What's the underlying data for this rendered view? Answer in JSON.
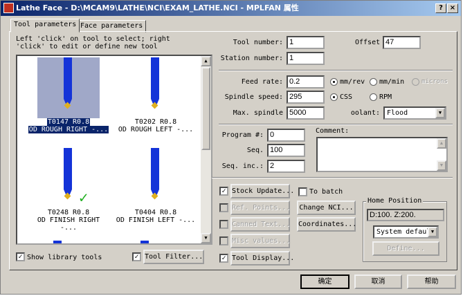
{
  "window": {
    "title": "Lathe Face - D:\\MCAM9\\LATHE\\NCI\\EXAM_LATHE.NCI - MPLFAN 属性",
    "help_btn": "?",
    "close_btn": "×"
  },
  "tabs": [
    {
      "label": "Tool parameters"
    },
    {
      "label": "Face parameters"
    }
  ],
  "instructions": [
    "Left 'click' on tool to select; right",
    "'click' to edit or define new tool"
  ],
  "tools": [
    {
      "id": "T0147 R0.8",
      "name": "OD ROUGH RIGHT -...",
      "selected": true
    },
    {
      "id": "T0202 R0.8",
      "name": "OD ROUGH LEFT -..."
    },
    {
      "id": "T0248 R0.8",
      "name": "OD FINISH RIGHT -...",
      "check": "✓"
    },
    {
      "id": "T0404 R0.8",
      "name": "OD FINISH LEFT -..."
    }
  ],
  "show_library": {
    "label": "Show library tools",
    "checked": "✓"
  },
  "tool_filter": {
    "label": "Tool Filter...",
    "checked": "✓"
  },
  "fields": {
    "tool_number": {
      "label": "Tool number:",
      "value": "1"
    },
    "offset": {
      "label": "Offset",
      "value": "47"
    },
    "station_number": {
      "label": "Station number:",
      "value": "1"
    },
    "feed_rate": {
      "label": "Feed rate:",
      "value": "0.2"
    },
    "spindle_speed": {
      "label": "Spindle speed:",
      "value": "295"
    },
    "max_spindle": {
      "label": "Max. spindle",
      "value": "5000"
    },
    "coolant": {
      "label": "oolant:",
      "value": "Flood"
    },
    "program": {
      "label": "Program #:",
      "value": "0"
    },
    "seq": {
      "label": "Seq.",
      "value": "100"
    },
    "seq_inc": {
      "label": "Seq. inc.:",
      "value": "2"
    },
    "comment": {
      "label": "Comment:",
      "value": ""
    }
  },
  "feed_units": [
    "mm/rev",
    "mm/min",
    "microns"
  ],
  "spindle_modes": [
    "CSS",
    "RPM"
  ],
  "options": [
    {
      "label": "Stock Update...",
      "checked": "✓",
      "enabled": true
    },
    {
      "label": "Ref. Points...",
      "checked": "",
      "enabled": false
    },
    {
      "label": "Canned Text...",
      "checked": "",
      "enabled": false
    },
    {
      "label": "Misc values...",
      "checked": "",
      "enabled": false
    },
    {
      "label": "Tool Display...",
      "checked": "✓",
      "enabled": true
    }
  ],
  "to_batch": {
    "label": "To batch"
  },
  "change_nci": "Change NCI...",
  "coordinates": "Coordinates...",
  "home": {
    "title": "Home Position",
    "value": "D:100.   Z:200.",
    "mode": "System defaul",
    "define": "Define..."
  },
  "buttons": {
    "ok": "确定",
    "cancel": "取消",
    "help": "帮助"
  }
}
